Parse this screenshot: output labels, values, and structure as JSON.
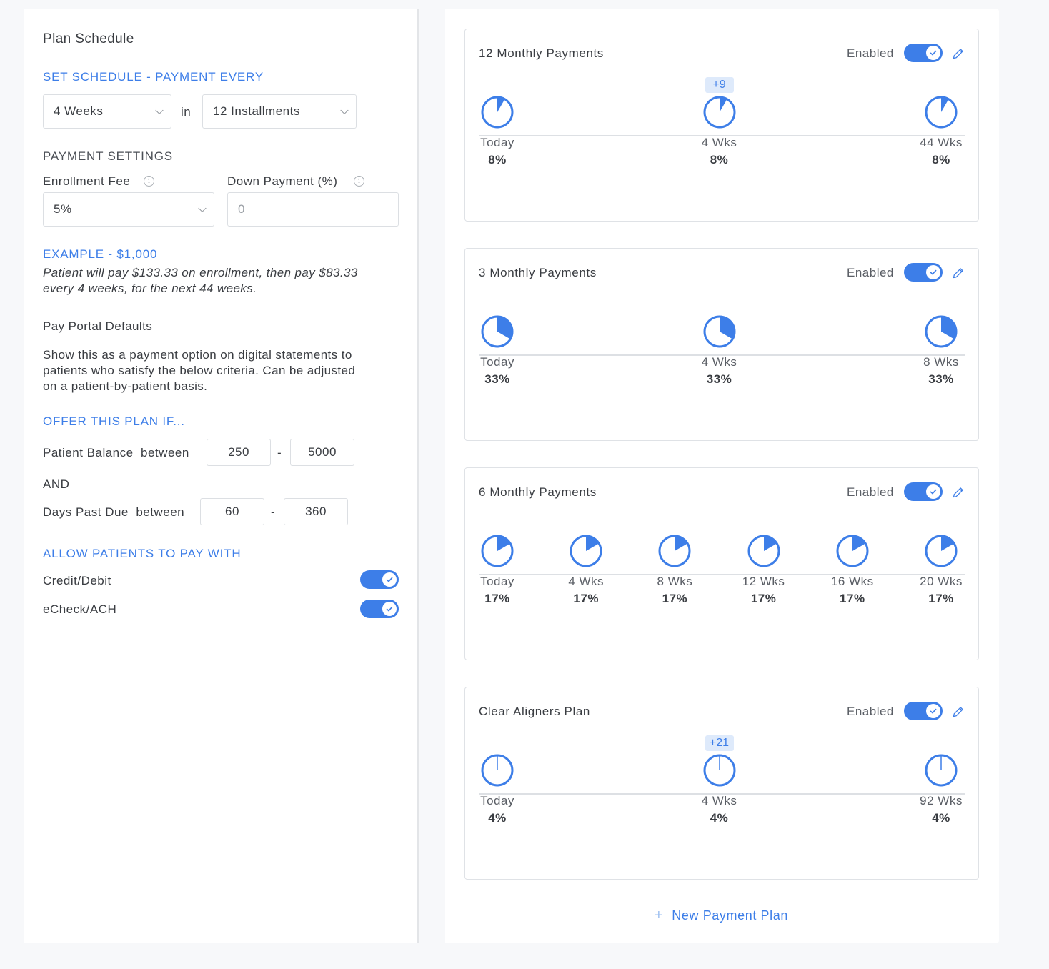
{
  "schedule": {
    "title": "Plan Schedule",
    "set_schedule_label": "SET SCHEDULE - PAYMENT EVERY",
    "interval_value": "4 Weeks",
    "in_label": "in",
    "installments_value": "12 Installments"
  },
  "payment_settings": {
    "label": "PAYMENT SETTINGS",
    "enrollment_fee_label": "Enrollment Fee",
    "enrollment_fee_value": "5%",
    "down_payment_label": "Down Payment (%)",
    "down_payment_placeholder": "0"
  },
  "example": {
    "heading": "EXAMPLE - $1,000",
    "line1": "Patient will pay $133.33 on enrollment, then pay $83.33",
    "line2": "every 4 weeks, for the next 44 weeks."
  },
  "portal": {
    "title": "Pay Portal Defaults",
    "line1": "Show this as a payment option on digital statements to",
    "line2": "patients who satisfy the below criteria. Can be adjusted",
    "line3": "on a patient-by-patient basis."
  },
  "offer": {
    "heading": "OFFER THIS PLAN IF...",
    "balance_label": "Patient Balance  between",
    "balance_min": "250",
    "balance_max": "5000",
    "dash": "-",
    "and_label": "AND",
    "days_label": "Days Past Due  between",
    "days_min": "60",
    "days_max": "360"
  },
  "allow": {
    "heading": "ALLOW PATIENTS TO PAY WITH",
    "credit_label": "Credit/Debit",
    "credit_enabled": true,
    "echeck_label": "eCheck/ACH",
    "echeck_enabled": true
  },
  "plans": [
    {
      "title": "12 Monthly Payments",
      "enabled_label": "Enabled",
      "enabled": true,
      "fraction": 0.0833,
      "points": [
        {
          "label": "Today",
          "pct": "8%"
        },
        {
          "label": "4 Wks",
          "pct": "8%",
          "badge": "+9"
        },
        {
          "label": "44 Wks",
          "pct": "8%"
        }
      ]
    },
    {
      "title": "3 Monthly Payments",
      "enabled_label": "Enabled",
      "enabled": true,
      "fraction": 0.3333,
      "points": [
        {
          "label": "Today",
          "pct": "33%"
        },
        {
          "label": "4 Wks",
          "pct": "33%"
        },
        {
          "label": "8 Wks",
          "pct": "33%"
        }
      ]
    },
    {
      "title": "6 Monthly Payments",
      "enabled_label": "Enabled",
      "enabled": true,
      "fraction": 0.1667,
      "points": [
        {
          "label": "Today",
          "pct": "17%"
        },
        {
          "label": "4 Wks",
          "pct": "17%"
        },
        {
          "label": "8 Wks",
          "pct": "17%"
        },
        {
          "label": "12 Wks",
          "pct": "17%"
        },
        {
          "label": "16 Wks",
          "pct": "17%"
        },
        {
          "label": "20 Wks",
          "pct": "17%"
        }
      ]
    },
    {
      "title": "Clear Aligners Plan",
      "enabled_label": "Enabled",
      "enabled": true,
      "fraction": 0.0417,
      "points": [
        {
          "label": "Today",
          "pct": "4%"
        },
        {
          "label": "4 Wks",
          "pct": "4%",
          "badge": "+21"
        },
        {
          "label": "92 Wks",
          "pct": "4%"
        }
      ]
    }
  ],
  "new_plan_label": "New Payment Plan",
  "colors": {
    "accent": "#3d7ee8",
    "badge_bg": "#deeafb",
    "border": "#dfe2e6"
  }
}
